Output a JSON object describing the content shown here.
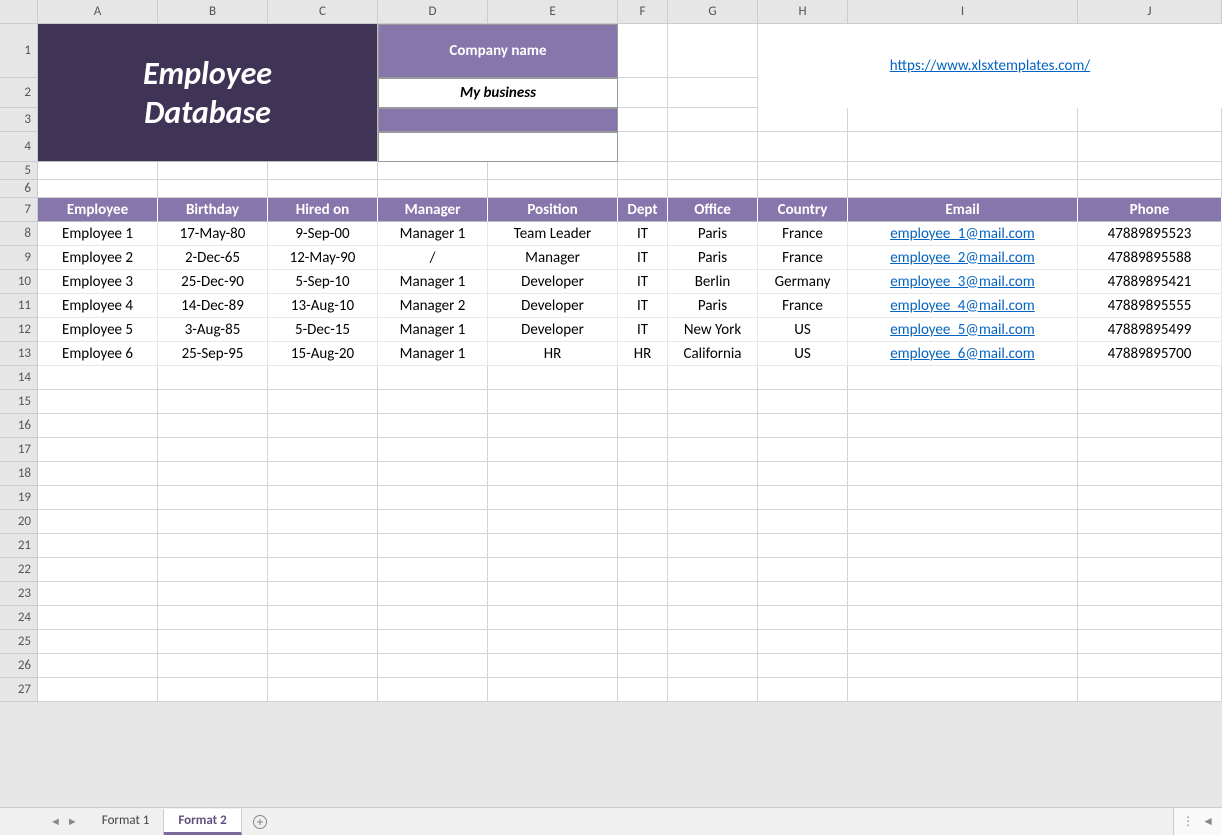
{
  "columns": [
    "A",
    "B",
    "C",
    "D",
    "E",
    "F",
    "G",
    "H",
    "I",
    "J"
  ],
  "row_numbers": [
    1,
    2,
    3,
    4,
    5,
    6,
    7,
    8,
    9,
    10,
    11,
    12,
    13,
    14,
    15,
    16,
    17,
    18,
    19,
    20,
    21,
    22,
    23,
    24,
    25,
    26,
    27
  ],
  "title_line1": "Employee",
  "title_line2": "Database",
  "company_label": "Company name",
  "company_value": "My business",
  "link_text": "https://www.xlsxtemplates.com/",
  "table": {
    "headers": [
      "Employee",
      "Birthday",
      "Hired on",
      "Manager",
      "Position",
      "Dept",
      "Office",
      "Country",
      "Email",
      "Phone"
    ],
    "rows": [
      {
        "employee": "Employee 1",
        "birthday": "17-May-80",
        "hired": "9-Sep-00",
        "manager": "Manager 1",
        "position": "Team Leader",
        "dept": "IT",
        "office": "Paris",
        "country": "France",
        "email": "employee_1@mail.com",
        "phone": "47889895523"
      },
      {
        "employee": "Employee 2",
        "birthday": "2-Dec-65",
        "hired": "12-May-90",
        "manager": "/",
        "position": "Manager",
        "dept": "IT",
        "office": "Paris",
        "country": "France",
        "email": "employee_2@mail.com",
        "phone": "47889895588"
      },
      {
        "employee": "Employee 3",
        "birthday": "25-Dec-90",
        "hired": "5-Sep-10",
        "manager": "Manager 1",
        "position": "Developer",
        "dept": "IT",
        "office": "Berlin",
        "country": "Germany",
        "email": "employee_3@mail.com",
        "phone": "47889895421"
      },
      {
        "employee": "Employee 4",
        "birthday": "14-Dec-89",
        "hired": "13-Aug-10",
        "manager": "Manager 2",
        "position": "Developer",
        "dept": "IT",
        "office": "Paris",
        "country": "France",
        "email": "employee_4@mail.com",
        "phone": "47889895555"
      },
      {
        "employee": "Employee 5",
        "birthday": "3-Aug-85",
        "hired": "5-Dec-15",
        "manager": "Manager 1",
        "position": "Developer",
        "dept": "IT",
        "office": "New York",
        "country": "US",
        "email": "employee_5@mail.com",
        "phone": "47889895499"
      },
      {
        "employee": "Employee 6",
        "birthday": "25-Sep-95",
        "hired": "15-Aug-20",
        "manager": "Manager 1",
        "position": "HR",
        "dept": "HR",
        "office": "California",
        "country": "US",
        "email": "employee_6@mail.com",
        "phone": "47889895700"
      }
    ]
  },
  "tabs": {
    "items": [
      "Format 1",
      "Format 2"
    ],
    "active": 1
  }
}
